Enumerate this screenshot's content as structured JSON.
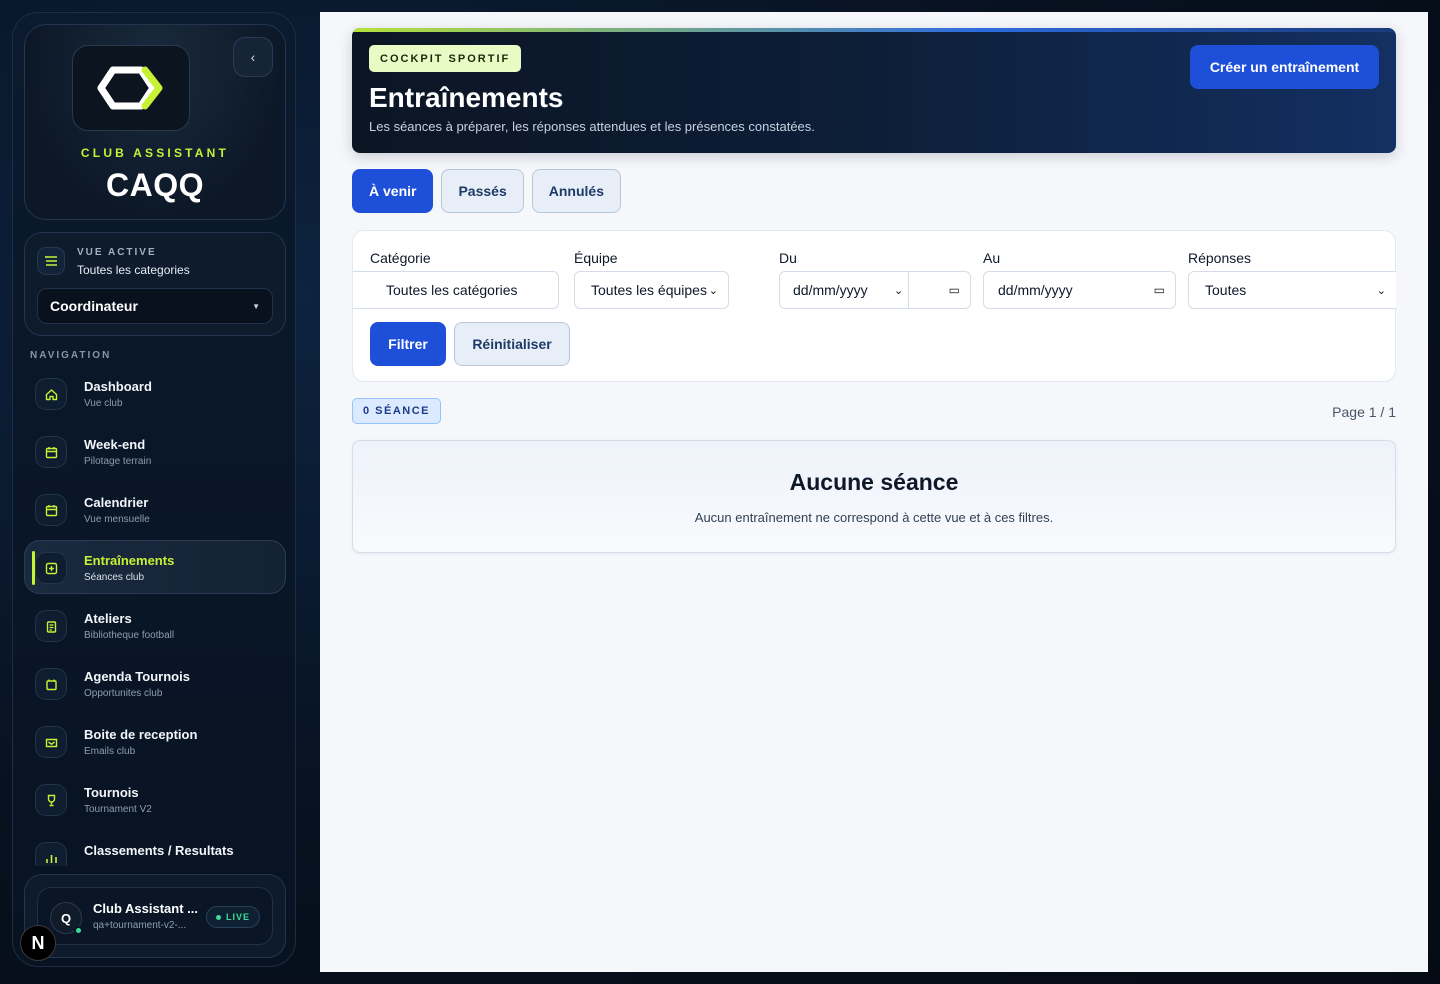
{
  "sidebar": {
    "brand_kicker": "CLUB ASSISTANT",
    "brand_name": "CAQQ",
    "collapse_icon": "‹",
    "view_kicker": "VUE ACTIVE",
    "view_value": "Toutes les categories",
    "role": "Coordinateur",
    "nav_title": "NAVIGATION",
    "items": [
      {
        "label": "Dashboard",
        "sub": "Vue club",
        "icon": "home-icon"
      },
      {
        "label": "Week-end",
        "sub": "Pilotage terrain",
        "icon": "calendar-icon"
      },
      {
        "label": "Calendrier",
        "sub": "Vue mensuelle",
        "icon": "calendar-icon"
      },
      {
        "label": "Entraînements",
        "sub": "Séances club",
        "icon": "training-icon"
      },
      {
        "label": "Ateliers",
        "sub": "Bibliotheque football",
        "icon": "clipboard-icon"
      },
      {
        "label": "Agenda Tournois",
        "sub": "Opportunites club",
        "icon": "folder-icon"
      },
      {
        "label": "Boite de reception",
        "sub": "Emails club",
        "icon": "inbox-icon"
      },
      {
        "label": "Tournois",
        "sub": "Tournament V2",
        "icon": "trophy-icon"
      },
      {
        "label": "Classements / Resultats",
        "sub": "",
        "icon": "chart-icon"
      }
    ],
    "user": {
      "initial": "Q",
      "name": "Club Assistant ...",
      "email": "qa+tournament-v2-...",
      "status": "LIVE"
    },
    "next_badge": "N"
  },
  "hero": {
    "kicker": "COCKPIT SPORTIF",
    "title": "Entraînements",
    "description": "Les séances à préparer, les réponses attendues et les présences constatées.",
    "create_label": "Créer un entraînement"
  },
  "tabs": [
    {
      "label": "À venir",
      "active": true
    },
    {
      "label": "Passés",
      "active": false
    },
    {
      "label": "Annulés",
      "active": false
    }
  ],
  "filters": {
    "category_label": "Catégorie",
    "category_value": "Toutes les catégories",
    "team_label": "Équipe",
    "team_value": "Toutes les équipes",
    "from_label": "Du",
    "from_value": "dd/mm/yyyy",
    "to_label": "Au",
    "to_value": "dd/mm/yyyy",
    "responses_label": "Réponses",
    "responses_value": "Toutes",
    "filter_button": "Filtrer",
    "reset_button": "Réinitialiser"
  },
  "results": {
    "count_badge": "0 SÉANCE",
    "page_info": "Page 1 / 1",
    "empty_title": "Aucune séance",
    "empty_desc": "Aucun entraînement ne correspond à cette vue et à ces filtres."
  },
  "colors": {
    "accent_lime": "#c6f135",
    "primary_blue": "#1e4fd8",
    "sidebar_bg": "#0b1a2e",
    "main_bg": "#f5f7fb"
  }
}
